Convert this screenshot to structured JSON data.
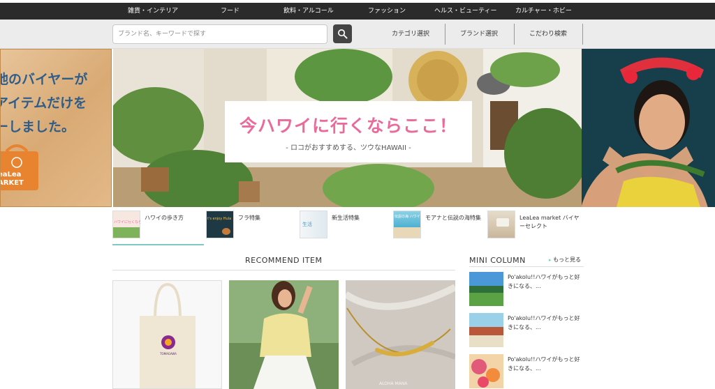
{
  "top_nav": {
    "items": [
      {
        "label": "雑貨・インテリア"
      },
      {
        "label": "フード"
      },
      {
        "label": "飲料・アルコール"
      },
      {
        "label": "ファッション"
      },
      {
        "label": "ヘルス・ビューティー"
      },
      {
        "label": "カルチャー・ホビー"
      }
    ]
  },
  "search": {
    "placeholder": "ブランド名、キーワードで探す",
    "value": ""
  },
  "header_links": {
    "category": "カテゴリ選択",
    "brand": "ブランド選択",
    "kodawari": "こだわり検索"
  },
  "hero_left": {
    "lines": [
      "地のバイヤーが",
      "アイテムだけを",
      "ーしました。"
    ],
    "logo_lines": [
      "eaLea",
      "ARKET"
    ]
  },
  "hero": {
    "headline": "今ハワイに行くならここ！",
    "subline": "- ロコがおすすめする、ツウなHAWAII -"
  },
  "features": {
    "items": [
      {
        "label": "ハワイの歩き方",
        "thumb_text": "ハワイに行くならここ"
      },
      {
        "label": "フラ特集",
        "thumb_text": "t's enjoy Hula"
      },
      {
        "label": "新生活特集",
        "thumb_text": "生活"
      },
      {
        "label": "モアナと伝説の海特集",
        "thumb_text": "伝説の海 ハワイ"
      },
      {
        "label": "LeaLea market バイヤーセレクト",
        "thumb_text": ""
      }
    ]
  },
  "recommend": {
    "title": "RECOMMEND ITEM",
    "items": [
      {
        "alt": "tote-bag",
        "brand_text": "TOMAGAWA"
      },
      {
        "alt": "yellow-shirt"
      },
      {
        "alt": "gold-necklace",
        "watermark": "ALOHA MANA"
      }
    ]
  },
  "mini_column": {
    "title": "MINI COLUMN",
    "more_label": "もっと見る",
    "items": [
      {
        "text": "Po'akolu!!ハワイがもっと好きになる、..."
      },
      {
        "text": "Po'akolu!!ハワイがもっと好きになる、..."
      },
      {
        "text": "Po'akolu!!ハワイがもっと好きになる、..."
      }
    ]
  },
  "colors": {
    "nav_bg": "#2b2b2b",
    "headline_pink": "#e86b9b",
    "accent_teal": "#7fc9c5",
    "left_banner_text": "#2f5d8a"
  }
}
